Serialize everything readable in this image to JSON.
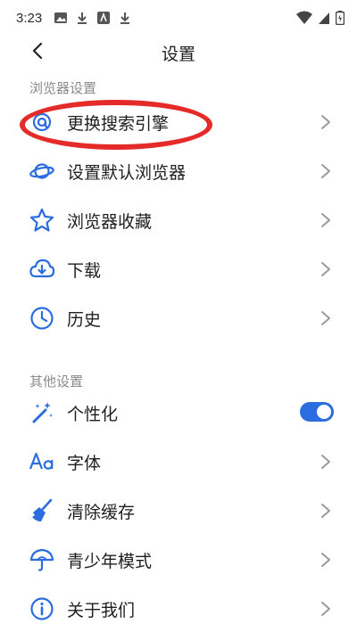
{
  "status_bar": {
    "time": "3:23",
    "icons": [
      "image-icon",
      "download-icon",
      "app-a-icon",
      "download-icon"
    ],
    "right_icons": [
      "wifi-icon",
      "signal-icon",
      "battery-icon"
    ]
  },
  "header": {
    "title": "设置"
  },
  "sections": {
    "browser_label": "浏览器设置",
    "other_label": "其他设置"
  },
  "items": {
    "search_engine": "更换搜索引擎",
    "default_browser": "设置默认浏览器",
    "favorites": "浏览器收藏",
    "download": "下载",
    "history": "历史",
    "personalize": "个性化",
    "font": "字体",
    "clear_cache": "清除缓存",
    "youth_mode": "青少年模式",
    "about": "关于我们"
  },
  "personalize_enabled": true,
  "colors": {
    "accent": "#2b6de0",
    "highlight": "#e52a2a"
  }
}
